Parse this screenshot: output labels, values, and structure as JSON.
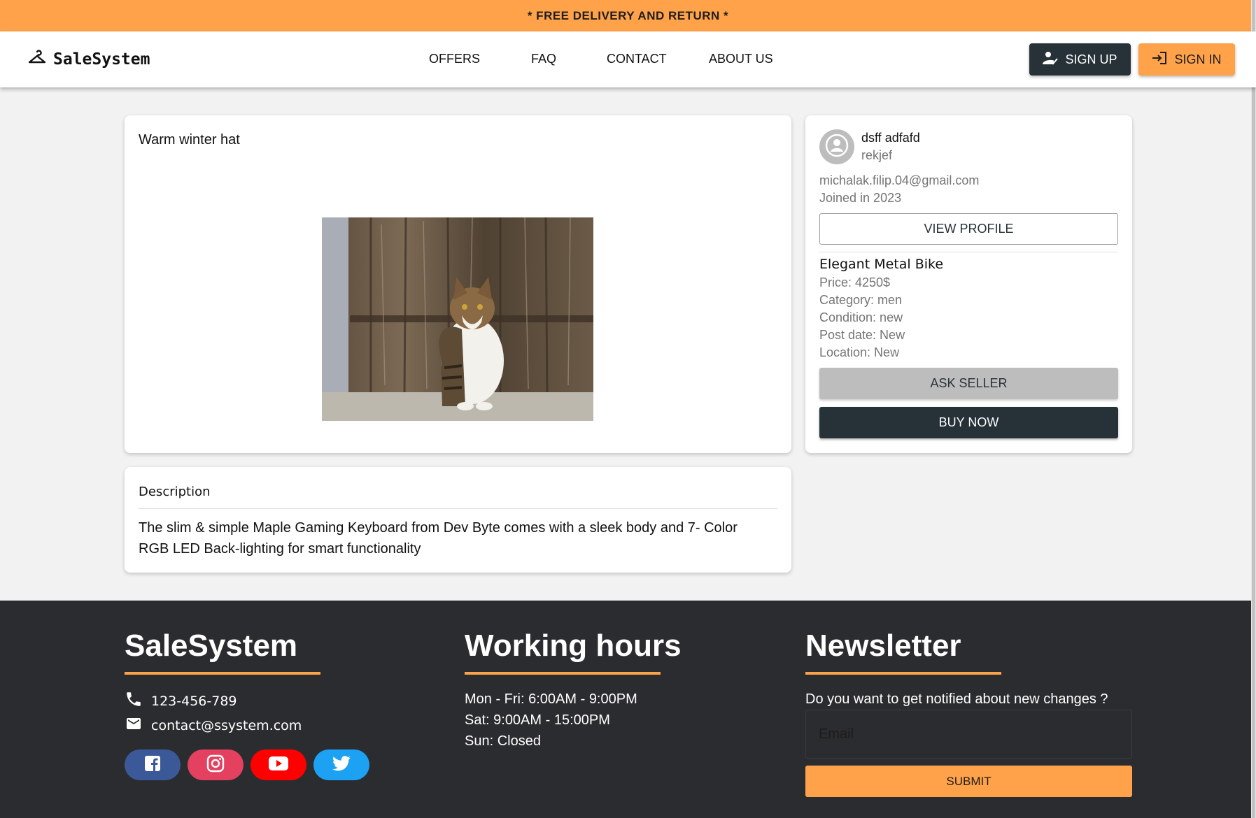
{
  "banner": {
    "text": "* FREE DELIVERY AND RETURN *"
  },
  "header": {
    "logo_text": "SaleSystem",
    "nav": [
      "OFFERS",
      "FAQ",
      "CONTACT",
      "ABOUT US"
    ],
    "signup_label": "SIGN UP",
    "signin_label": "SIGN IN",
    "colors": {
      "accent": "#ffa24a",
      "dark": "#263238"
    }
  },
  "product": {
    "title": "Warm winter hat",
    "image_subject": "cat sitting in front of wooden door"
  },
  "description": {
    "heading": "Description",
    "text": "The slim & simple Maple Gaming Keyboard from Dev Byte comes with a sleek body and 7- Color RGB LED Back-lighting for smart functionality"
  },
  "seller": {
    "name": "dsff adfafd",
    "username": "rekjef",
    "email": "michalak.filip.04@gmail.com",
    "joined": "Joined in 2023",
    "view_profile_label": "VIEW PROFILE"
  },
  "item": {
    "name": "Elegant Metal Bike",
    "price": "Price: 4250$",
    "category": "Category: men",
    "condition": "Condition: new",
    "post_date": "Post date: New",
    "location": "Location: New",
    "ask_label": "ASK SELLER",
    "buy_label": "BUY NOW"
  },
  "footer": {
    "brand_heading": "SaleSystem",
    "phone": "123-456-789",
    "email": "contact@ssystem.com",
    "social": [
      "facebook-icon",
      "instagram-icon",
      "youtube-icon",
      "twitter-icon"
    ],
    "hours_heading": "Working hours",
    "hours": [
      "Mon - Fri: 6:00AM - 9:00PM",
      "Sat: 9:00AM - 15:00PM",
      "Sun: Closed"
    ],
    "newsletter_heading": "Newsletter",
    "newsletter_question": "Do you want to get notified about new changes ?",
    "email_placeholder": "Email",
    "submit_label": "SUBMIT"
  }
}
